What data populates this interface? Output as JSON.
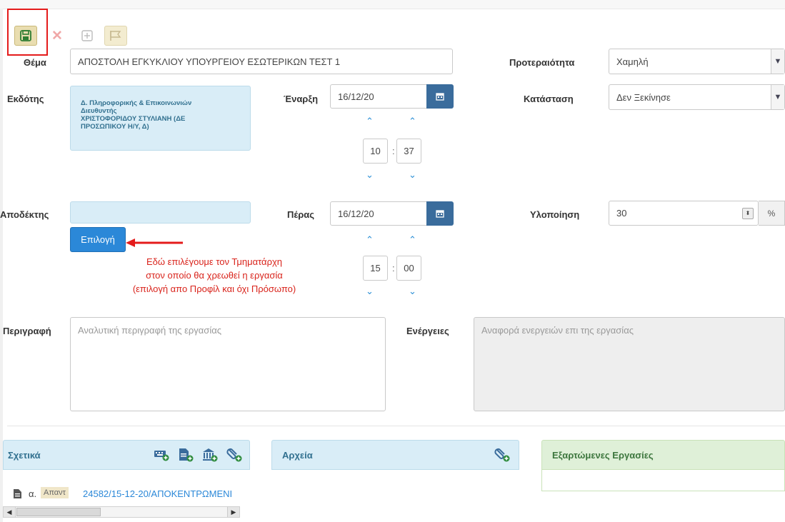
{
  "toolbar": {
    "save_icon": "save-icon",
    "delete_icon": "close-icon",
    "add_icon": "plus-icon",
    "flag_icon": "flag-icon"
  },
  "form": {
    "subject_label": "Θέμα",
    "subject_value": "ΑΠΟΣΤΟΛΗ ΕΓΚΥΚΛΙΟΥ ΥΠΟΥΡΓΕΙΟΥ ΕΣΩΤΕΡΙΚΩΝ ΤΕΣΤ 1",
    "priority_label": "Προτεραιότητα",
    "priority_value": "Χαμηλή",
    "issuer_label": "Εκδότης",
    "issuer_lines": [
      "Δ. Πληροφορικής & Επικοινωνιών",
      "Διευθυντής",
      "ΧΡΙΣΤΟΦΟΡΙΔΟΥ ΣΤΥΛΙΑΝΗ (ΔΕ",
      "ΠΡΟΣΩΠΙΚΟΥ Η/Υ, Δ)"
    ],
    "start_label": "Έναρξη",
    "start_date": "16/12/20",
    "start_hour": "10",
    "start_minute": "37",
    "status_label": "Κατάσταση",
    "status_value": "Δεν Ξεκίνησε",
    "recipient_label": "Αποδέκτης",
    "select_button": "Επιλογή",
    "end_label": "Πέρας",
    "end_date": "16/12/20",
    "end_hour": "15",
    "end_minute": "00",
    "progress_label": "Υλοποίηση",
    "progress_value": "30",
    "progress_unit": "%",
    "description_label": "Περιγραφή",
    "description_placeholder": "Αναλυτική περιγραφή της εργασίας",
    "actions_label": "Ενέργειες",
    "actions_placeholder": "Αναφορά ενεργειών επι της εργασίας"
  },
  "annotation": {
    "lines": [
      "Εδώ επιλέγουμε τον Τμηματάρχη",
      "στον οποίο θα χρεωθεί η εργασία",
      "(επιλογή απο Προφίλ και όχι Πρόσωπο)"
    ],
    "color": "#d9241c"
  },
  "panels": {
    "related_title": "Σχετικά",
    "files_title": "Αρχεία",
    "dependent_title": "Εξαρτώμενες Εργασίες",
    "related_item_prefix": "α.",
    "related_item_badge": "Απαντ",
    "related_item_link": "24582/15-12-20/ΑΠΟΚΕΝΤΡΩΜΕΝΙ"
  },
  "colors": {
    "accent_dark": "#3a6c9c",
    "accent_blue": "#2b88d8",
    "highlight_red": "#e41b1b"
  }
}
